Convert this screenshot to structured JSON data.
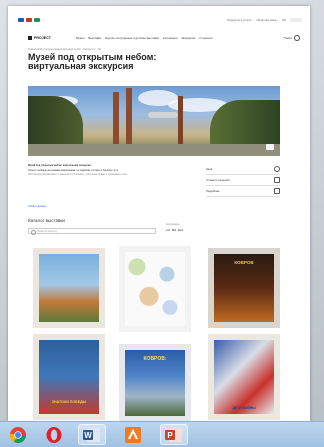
{
  "topbar": {
    "links": [
      "Продукты и услуги",
      "Обратная связь",
      "RU"
    ]
  },
  "nav": {
    "brand": "PROJECT",
    "menu": [
      "Музеи",
      "Выставки",
      "Научно-популярные и детские выставки",
      "Коллекции",
      "Экскурсии",
      "О проекте"
    ],
    "search_label": "Поиск"
  },
  "page": {
    "breadcrumbs": "Ковровский историко-мемориальный музей · Экскурсия · 3D",
    "title": "Музей под открытым небом: виртуальная экскурсия"
  },
  "description": {
    "paragraphs": [
      "Музей под открытым небом: виртуальная экскурсия",
      "Проект посвящён ветеранам-ковровчанам: их подвигам, истории и боевому пути.",
      "Экспозиция рассказывает о знаменитых земляках, участниках войны и тружениках тыла."
    ],
    "more_link": "Читать далее ›"
  },
  "side_actions": [
    {
      "label": "Цена",
      "icon": "info-icon"
    },
    {
      "label": "Отзывы и рецензии",
      "icon": "share-icon"
    },
    {
      "label": "Подробнее",
      "icon": "warning-icon"
    }
  ],
  "catalog": {
    "title": "Каталог выставки",
    "search_placeholder": "Поиск по каталогу",
    "sort_label": "Сортировать",
    "sort_options": [
      "А-Я",
      "Я-А",
      "Дата"
    ]
  },
  "cards": [
    {
      "label": ""
    },
    {
      "label": ""
    },
    {
      "label": "КОВРОВ"
    },
    {
      "label": "ЗНАТОКИ ПОБЕДЫ"
    },
    {
      "label": "КОВРОВ:"
    },
    {
      "label": "ДЕТИ ВОЙНЫ"
    }
  ],
  "taskbar": {
    "apps": [
      "chrome-icon",
      "opera-icon",
      "word-icon",
      "xmind-icon",
      "powerpoint-icon"
    ]
  },
  "colors": {
    "accent": "#2a5db0",
    "card_bg": "#ebe6df",
    "taskbar": "#a8c7e6"
  }
}
